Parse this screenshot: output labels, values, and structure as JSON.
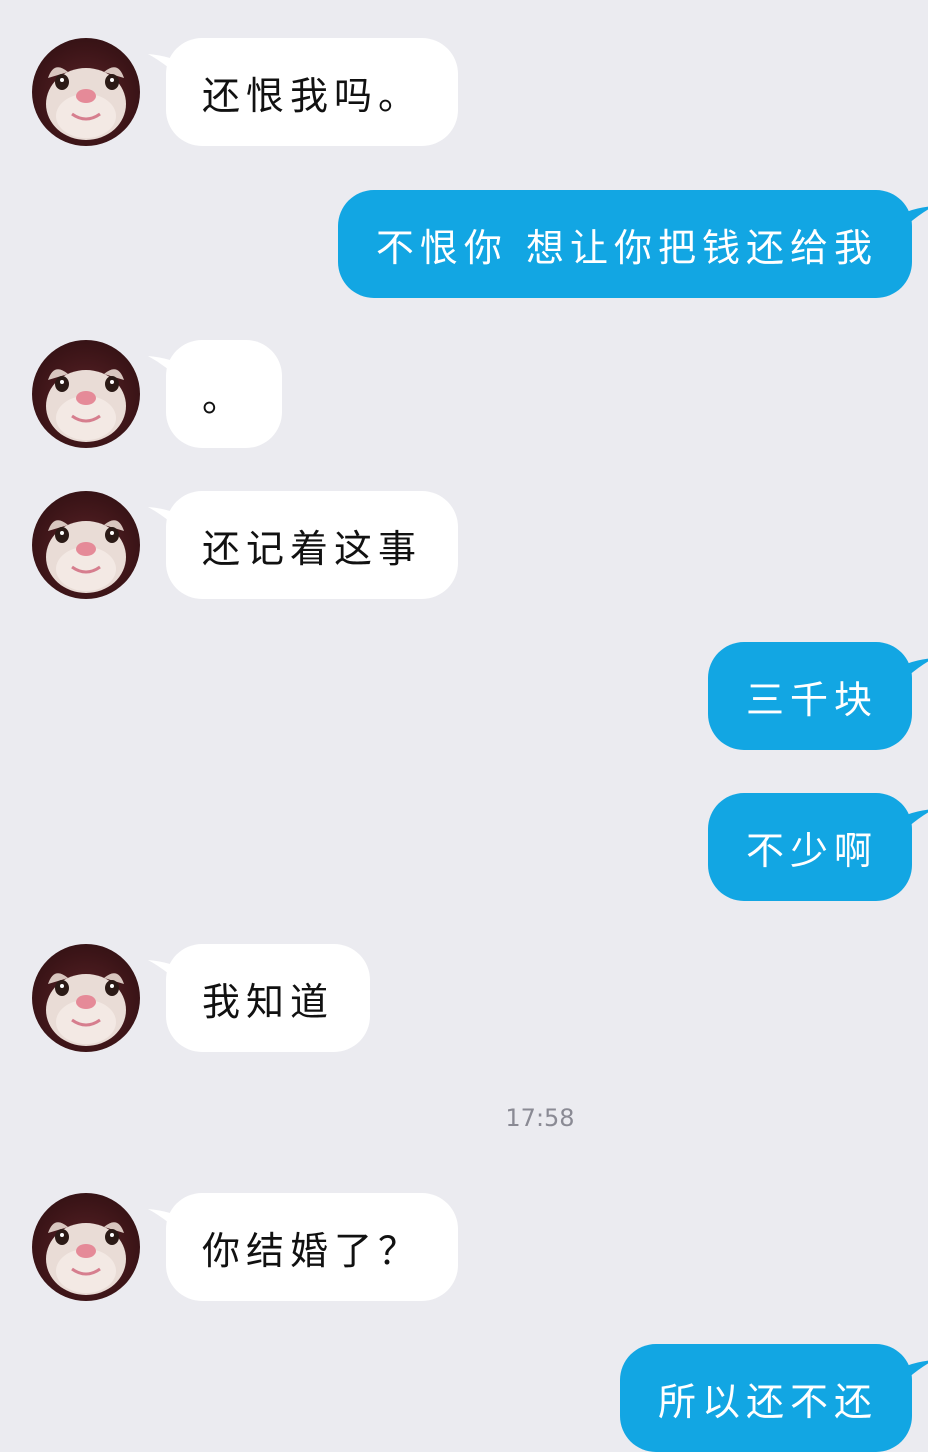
{
  "chat": {
    "messages": [
      {
        "id": "m1",
        "side": "in",
        "text": "还恨我吗。"
      },
      {
        "id": "m2",
        "side": "out",
        "text": "不恨你 想让你把钱还给我"
      },
      {
        "id": "m3",
        "side": "in",
        "text": "。"
      },
      {
        "id": "m4",
        "side": "in",
        "text": "还记着这事"
      },
      {
        "id": "m5",
        "side": "out",
        "text": "三千块"
      },
      {
        "id": "m6",
        "side": "out",
        "text": "不少啊"
      },
      {
        "id": "m7",
        "side": "in",
        "text": "我知道"
      },
      {
        "id": "m8",
        "side": "in",
        "text": "你结婚了？"
      },
      {
        "id": "m9",
        "side": "out",
        "text": "所以还不还"
      }
    ],
    "timestamp": "17:58"
  },
  "colors": {
    "background": "#ebebf0",
    "incoming_bubble": "#ffffff",
    "outgoing_bubble": "#12a6e3",
    "timestamp_text": "#8a8a94"
  },
  "icons": {
    "avatar": "cat-face-avatar"
  }
}
